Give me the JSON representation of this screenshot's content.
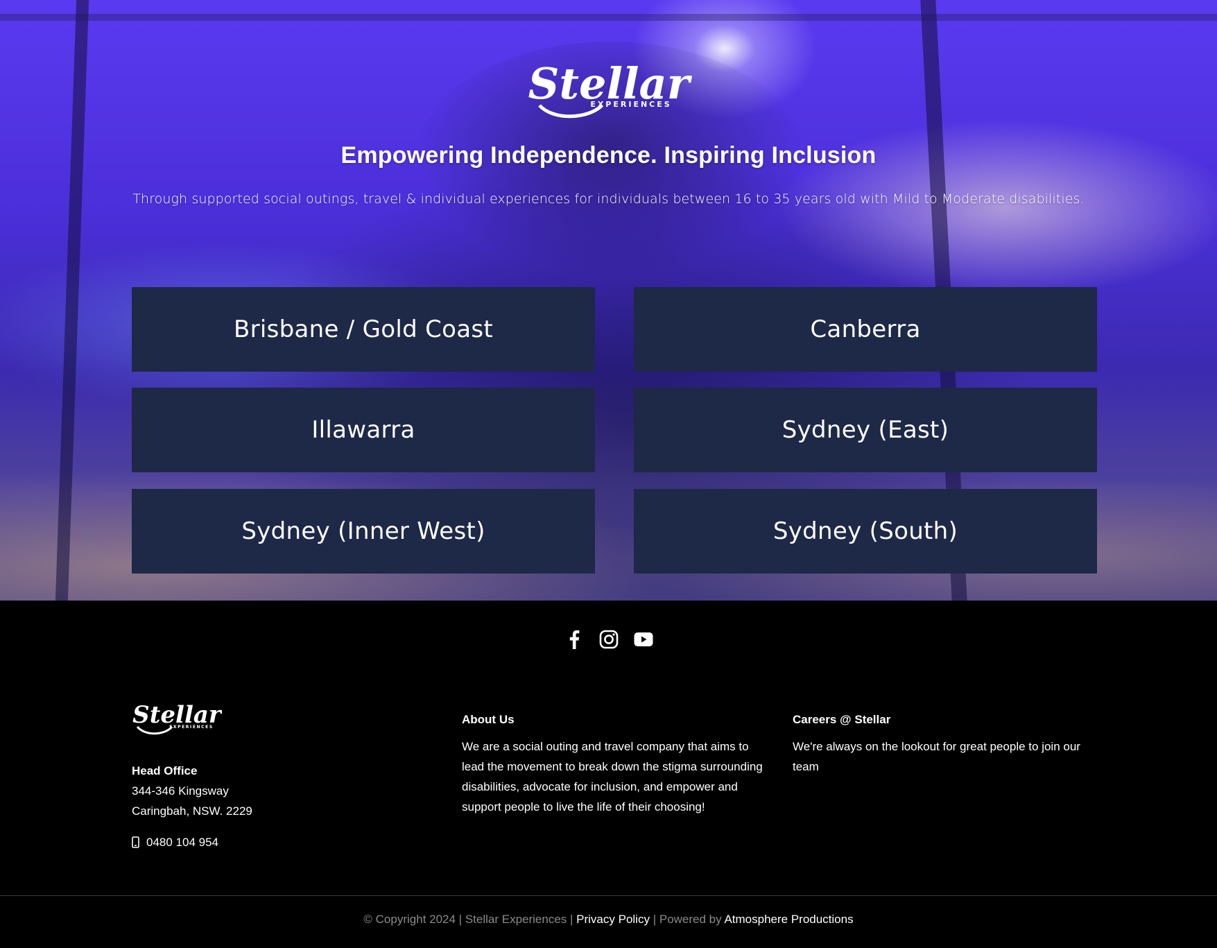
{
  "hero": {
    "logo": {
      "wordmark": "Stellar",
      "tagline": "EXPERIENCES"
    },
    "headline": "Empowering Independence. Inspiring Inclusion",
    "subheadline": "Through supported social outings, travel & individual experiences for individuals between 16 to 35 years old with Mild to Moderate disabilities.",
    "locations": [
      {
        "label": "Brisbane / Gold Coast"
      },
      {
        "label": "Canberra"
      },
      {
        "label": "Illawarra"
      },
      {
        "label": "Sydney (East)"
      },
      {
        "label": "Sydney (Inner West)"
      },
      {
        "label": "Sydney (South)"
      }
    ]
  },
  "footer": {
    "social": [
      {
        "icon": "facebook-icon"
      },
      {
        "icon": "instagram-icon"
      },
      {
        "icon": "youtube-icon"
      }
    ],
    "logo": {
      "wordmark": "Stellar",
      "tagline": "EXPERIENCES"
    },
    "head_office": {
      "title": "Head Office",
      "address_line1": "344-346 Kingsway",
      "address_line2": "Caringbah, NSW. 2229",
      "phone": "0480 104 954"
    },
    "about": {
      "title": "About Us",
      "text": "We are a social outing and travel company that aims to lead the movement to break down the stigma surrounding disabilities, advocate for inclusion, and empower and support people to live the life of their choosing!"
    },
    "careers": {
      "title": "Careers @ Stellar",
      "text": "We're always on the lookout for great people to join our team"
    },
    "bottom": {
      "copyright": "© Copyright 2024 | Stellar Experiences |",
      "privacy_label": "Privacy Policy",
      "separator": "|",
      "powered_label": "Powered by",
      "powered_link": "Atmosphere Productions"
    }
  },
  "colors": {
    "button_bg": "#1e2847",
    "footer_bg": "#000000",
    "hero_purple": "#4b2fd9",
    "muted_text": "#8a8a8a"
  }
}
